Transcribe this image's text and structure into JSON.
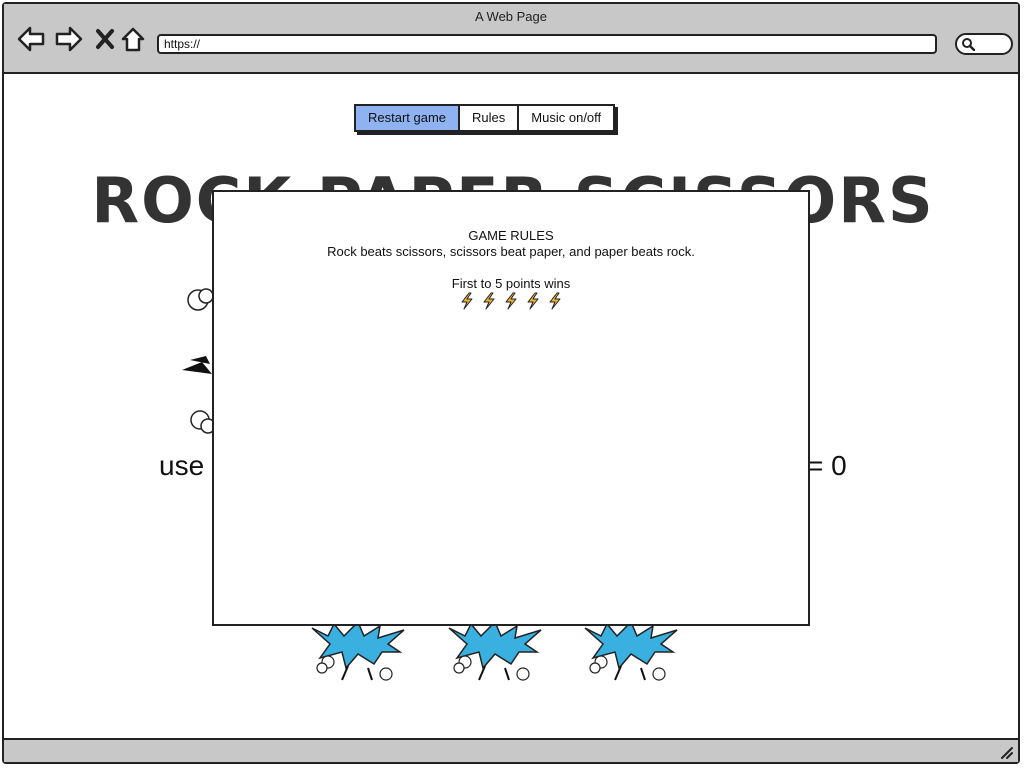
{
  "window": {
    "title": "A Web Page"
  },
  "address_bar": {
    "url": "https://"
  },
  "toolbar": {
    "buttons": [
      {
        "label": "Restart game",
        "active": true
      },
      {
        "label": "Rules",
        "active": false
      },
      {
        "label": "Music on/off",
        "active": false
      }
    ]
  },
  "game": {
    "heading": "ROCK PAPER SCISSORS",
    "score_left_fragment": "use",
    "score_right_fragment": "= 0"
  },
  "modal": {
    "title": "GAME RULES",
    "text": "Rock beats scissors, scissors beat paper, and paper beats rock.",
    "win_condition": "First to 5 points wins",
    "bolt_count": 5,
    "bolt_color": "#f2b233"
  },
  "colors": {
    "active_button": "#8fb2f0",
    "chrome": "#c8c8c8",
    "blast_blue": "#3ab0e0"
  }
}
